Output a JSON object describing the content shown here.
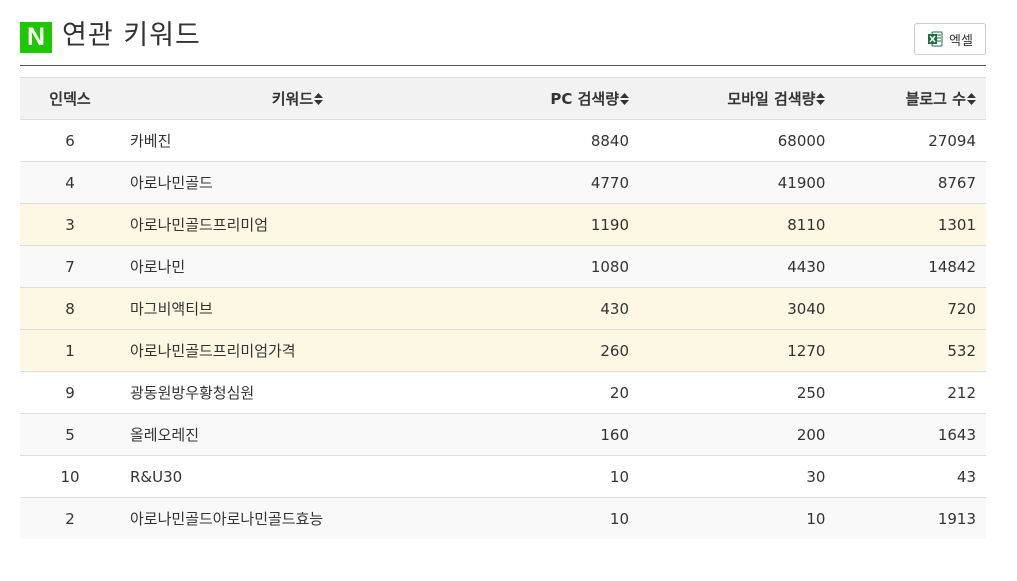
{
  "header": {
    "brand_letter": "N",
    "title": "연관 키워드",
    "excel_label": "엑셀",
    "excel_icon": "excel-icon"
  },
  "colors": {
    "brand_green": "#1ec800",
    "highlight_row": "#fcf8e3",
    "stripe_row": "#f9f9f9",
    "header_bg": "#f2f2f2"
  },
  "table": {
    "columns": [
      {
        "label": "인덱스",
        "sortable": false
      },
      {
        "label": "키워드",
        "sortable": true
      },
      {
        "label": "PC 검색량",
        "sortable": true
      },
      {
        "label": "모바일 검색량",
        "sortable": true
      },
      {
        "label": "블로그 수",
        "sortable": true
      }
    ],
    "rows": [
      {
        "index": "6",
        "keyword": "카베진",
        "pc": "8840",
        "mobile": "68000",
        "blog": "27094",
        "style": "white"
      },
      {
        "index": "4",
        "keyword": "아로나민골드",
        "pc": "4770",
        "mobile": "41900",
        "blog": "8767",
        "style": "gray"
      },
      {
        "index": "3",
        "keyword": "아로나민골드프리미엄",
        "pc": "1190",
        "mobile": "8110",
        "blog": "1301",
        "style": "yellow"
      },
      {
        "index": "7",
        "keyword": "아로나민",
        "pc": "1080",
        "mobile": "4430",
        "blog": "14842",
        "style": "gray"
      },
      {
        "index": "8",
        "keyword": "마그비액티브",
        "pc": "430",
        "mobile": "3040",
        "blog": "720",
        "style": "yellow"
      },
      {
        "index": "1",
        "keyword": "아로나민골드프리미엄가격",
        "pc": "260",
        "mobile": "1270",
        "blog": "532",
        "style": "yellow"
      },
      {
        "index": "9",
        "keyword": "광동원방우황청심원",
        "pc": "20",
        "mobile": "250",
        "blog": "212",
        "style": "white"
      },
      {
        "index": "5",
        "keyword": "올레오레진",
        "pc": "160",
        "mobile": "200",
        "blog": "1643",
        "style": "gray"
      },
      {
        "index": "10",
        "keyword": "R&U30",
        "pc": "10",
        "mobile": "30",
        "blog": "43",
        "style": "white"
      },
      {
        "index": "2",
        "keyword": "아로나민골드아로나민골드효능",
        "pc": "10",
        "mobile": "10",
        "blog": "1913",
        "style": "gray"
      }
    ]
  }
}
